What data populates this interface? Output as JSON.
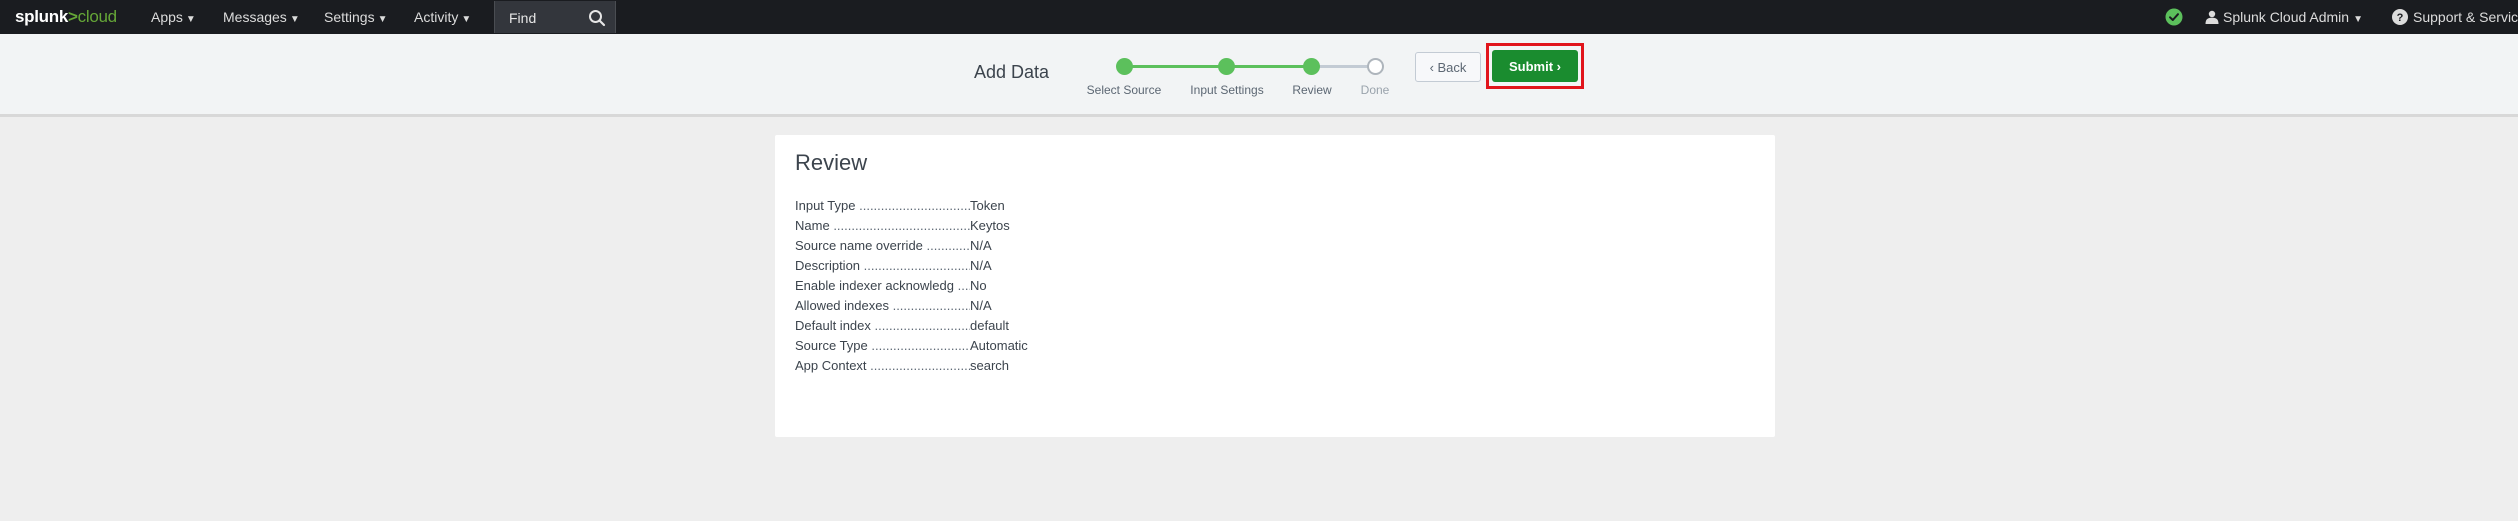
{
  "topbar": {
    "logo_main": "splunk",
    "logo_caret": ">",
    "logo_sub": "cloud",
    "nav": [
      {
        "label": "Apps",
        "icon": "chevron-down-icon"
      },
      {
        "label": "Messages",
        "icon": "chevron-down-icon"
      },
      {
        "label": "Settings",
        "icon": "chevron-down-icon"
      },
      {
        "label": "Activity",
        "icon": "chevron-down-icon"
      }
    ],
    "search": {
      "placeholder": "Find",
      "icon": "search-icon"
    },
    "status_icon": "check-circle-icon",
    "status_color": "#5cc05c",
    "user_label": "Splunk Cloud Admin",
    "support_label": "Support & Services"
  },
  "wizard": {
    "title": "Add Data",
    "steps": [
      {
        "label": "Select Source",
        "state": "complete"
      },
      {
        "label": "Input Settings",
        "state": "complete"
      },
      {
        "label": "Review",
        "state": "current"
      },
      {
        "label": "Done",
        "state": "pending"
      }
    ],
    "back_label": "Back",
    "submit_label": "Submit",
    "accent_color": "#5cc05c",
    "submit_color": "#1a8c2f",
    "highlight_color": "#e1141b"
  },
  "review": {
    "title": "Review",
    "rows": [
      {
        "key": "Input Type",
        "value": "Token"
      },
      {
        "key": "Name",
        "value": "Keytos"
      },
      {
        "key": "Source name override",
        "value": "N/A"
      },
      {
        "key": "Description",
        "value": "N/A"
      },
      {
        "key": "Enable indexer acknowledg",
        "value": "No"
      },
      {
        "key": "Allowed indexes",
        "value": "N/A"
      },
      {
        "key": "Default index",
        "value": "default"
      },
      {
        "key": "Source Type",
        "value": "Automatic"
      },
      {
        "key": "App Context",
        "value": "search"
      }
    ]
  }
}
